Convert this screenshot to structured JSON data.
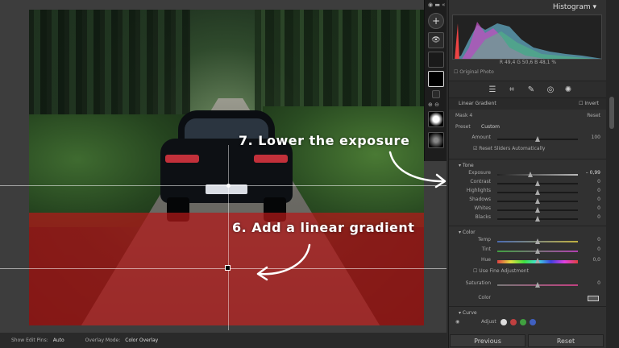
{
  "canvas": {
    "annotations": {
      "step7": "7. Lower the exposure",
      "step6": "6. Add a linear gradient"
    }
  },
  "bottom_bar": {
    "show_edit_pins_label": "Show Edit Pins:",
    "show_edit_pins_value": "Auto",
    "overlay_mode_label": "Overlay Mode:",
    "overlay_mode_value": "Color Overlay"
  },
  "panel": {
    "histogram_title": "Histogram",
    "hist_stats": "R  49,4  G  50,6  B  48,1 %",
    "original_photo": "Original Photo",
    "mask_title": "Linear Gradient",
    "invert_label": "Invert",
    "mask_name": "Mask 4",
    "reset_label": "Reset",
    "preset_label": "Preset",
    "preset_value": "Custom",
    "amount_label": "Amount",
    "amount_value": "100",
    "reset_sliders_label": "Reset Sliders Automatically",
    "tone_header": "Tone",
    "tone": [
      {
        "label": "Exposure",
        "value": "– 0,99"
      },
      {
        "label": "Contrast",
        "value": "0"
      },
      {
        "label": "Highlights",
        "value": "0"
      },
      {
        "label": "Shadows",
        "value": "0"
      },
      {
        "label": "Whites",
        "value": "0"
      },
      {
        "label": "Blacks",
        "value": "0"
      }
    ],
    "color_header": "Color",
    "color": [
      {
        "label": "Temp",
        "value": "0"
      },
      {
        "label": "Tint",
        "value": "0"
      },
      {
        "label": "Hue",
        "value": "0,0"
      }
    ],
    "use_fine_label": "Use Fine Adjustment",
    "saturation_label": "Saturation",
    "saturation_value": "0",
    "color_label": "Color",
    "curve_header": "Curve",
    "adjust_label": "Adjust",
    "previous_button": "Previous",
    "reset_button": "Reset"
  }
}
